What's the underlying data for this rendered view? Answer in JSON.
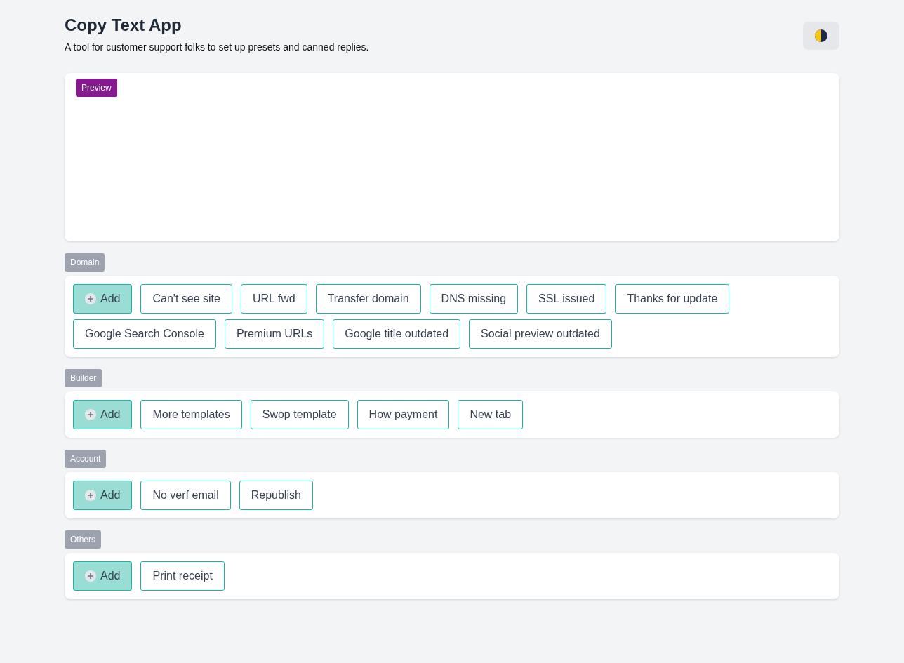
{
  "header": {
    "title": "Copy Text App",
    "subtitle": "A tool for customer support folks to set up presets and canned replies."
  },
  "preview": {
    "badge": "Preview"
  },
  "groups": [
    {
      "label": "Domain",
      "add_label": "Add",
      "presets": [
        "Can't see site",
        "URL fwd",
        "Transfer domain",
        "DNS missing",
        "SSL issued",
        "Thanks for update",
        "Google Search Console",
        "Premium URLs",
        "Google title outdated",
        "Social preview outdated"
      ]
    },
    {
      "label": "Builder",
      "add_label": "Add",
      "presets": [
        "More templates",
        "Swop template",
        "How payment",
        "New tab"
      ]
    },
    {
      "label": "Account",
      "add_label": "Add",
      "presets": [
        "No verf email",
        "Republish"
      ]
    },
    {
      "label": "Others",
      "add_label": "Add",
      "presets": [
        "Print receipt"
      ]
    }
  ]
}
